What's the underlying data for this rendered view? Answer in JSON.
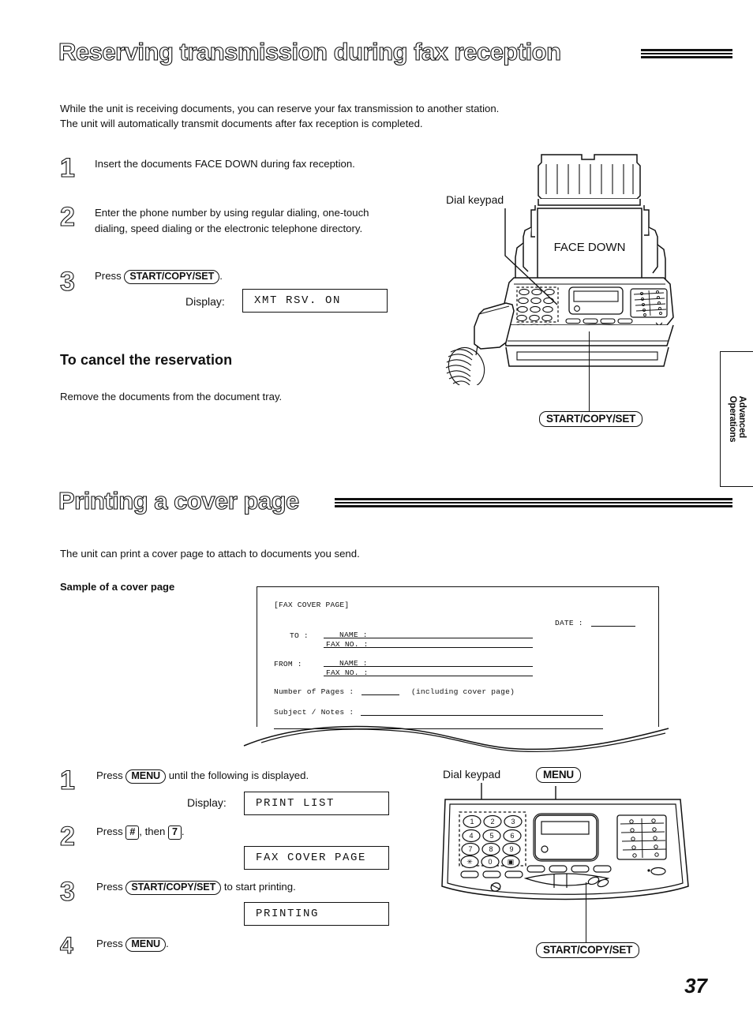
{
  "page": {
    "number": "37",
    "side_tab": {
      "line1": "Advanced",
      "line2": "Operations"
    }
  },
  "section1": {
    "heading": "Reserving transmission during fax reception",
    "intro": "While the unit is receiving documents, you can reserve your fax transmission to another station.\nThe unit will automatically transmit documents after fax reception is completed.",
    "steps": [
      {
        "num": "1",
        "text_before": "Insert the documents FACE DOWN during fax reception.",
        "key": "",
        "text_after": ""
      },
      {
        "num": "2",
        "text_before": "Enter the phone number by using regular dialing, one-touch dialing, speed dialing or the electronic telephone directory.",
        "key": "",
        "text_after": ""
      },
      {
        "num": "3",
        "text_before": "Press ",
        "key": "START/COPY/SET",
        "text_after": "."
      }
    ],
    "display_label": "Display:",
    "display_value": "XMT RSV. ON",
    "cancel_heading": "To cancel the reservation",
    "cancel_text": "Remove the documents from the document tray.",
    "diagram": {
      "dial_keypad_label": "Dial keypad",
      "face_down_label": "FACE DOWN",
      "start_callout": "START/COPY/SET"
    }
  },
  "section2": {
    "heading": "Printing a cover page",
    "intro": "The unit can print a cover page to attach to documents you send.",
    "sample_label": "Sample of a cover page",
    "cover_page": {
      "title": "[FAX COVER PAGE]",
      "date_label": "DATE :",
      "to_label": "TO :",
      "from_label": "FROM :",
      "name_label": "NAME :",
      "fax_no_label": "FAX NO. :",
      "pages_label": "Number of Pages :",
      "pages_note": "(including cover page)",
      "subject_label": "Subject / Notes :"
    },
    "steps": [
      {
        "num": "1",
        "text_before": "Press ",
        "key": "MENU",
        "text_after": " until the following is displayed."
      },
      {
        "num": "2",
        "text_before": "Press ",
        "key": "#",
        "text_after": ", then ",
        "key2": "7",
        "text_end": "."
      },
      {
        "num": "3",
        "text_before": "Press ",
        "key": "START/COPY/SET",
        "text_after": " to start printing."
      },
      {
        "num": "4",
        "text_before": "Press ",
        "key": "MENU",
        "text_after": "."
      }
    ],
    "display_label": "Display:",
    "display_1": "PRINT LIST",
    "display_2": "FAX COVER PAGE",
    "display_3": "PRINTING",
    "diagram": {
      "dial_keypad_label": "Dial keypad",
      "menu_callout": "MENU",
      "start_callout": "START/COPY/SET",
      "keypad_keys": [
        "1",
        "2",
        "3",
        "4",
        "5",
        "6",
        "7",
        "8",
        "9",
        "✳",
        "0",
        "▣"
      ]
    }
  }
}
